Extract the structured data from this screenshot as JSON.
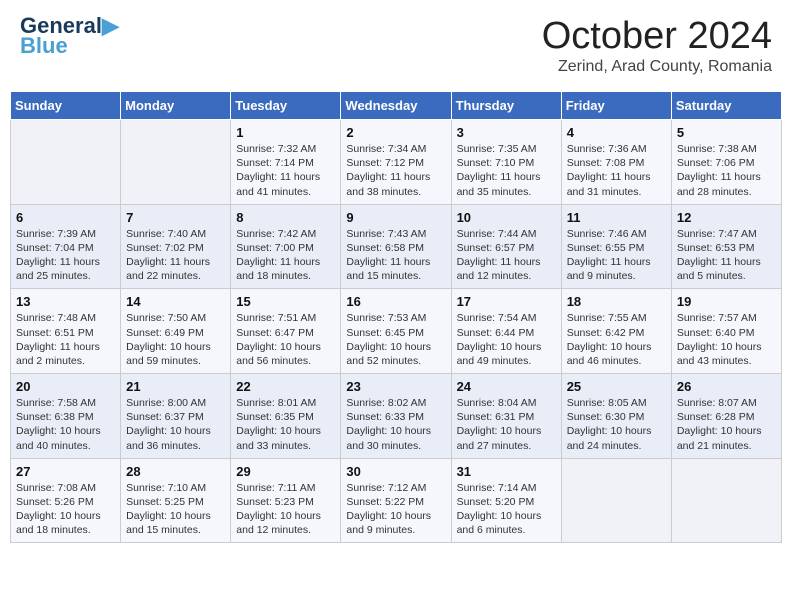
{
  "header": {
    "logo_general": "General",
    "logo_blue": "Blue",
    "title": "October 2024",
    "subtitle": "Zerind, Arad County, Romania"
  },
  "days_of_week": [
    "Sunday",
    "Monday",
    "Tuesday",
    "Wednesday",
    "Thursday",
    "Friday",
    "Saturday"
  ],
  "weeks": [
    [
      {
        "day": "",
        "sunrise": "",
        "sunset": "",
        "daylight": ""
      },
      {
        "day": "",
        "sunrise": "",
        "sunset": "",
        "daylight": ""
      },
      {
        "day": "1",
        "sunrise": "Sunrise: 7:32 AM",
        "sunset": "Sunset: 7:14 PM",
        "daylight": "Daylight: 11 hours and 41 minutes."
      },
      {
        "day": "2",
        "sunrise": "Sunrise: 7:34 AM",
        "sunset": "Sunset: 7:12 PM",
        "daylight": "Daylight: 11 hours and 38 minutes."
      },
      {
        "day": "3",
        "sunrise": "Sunrise: 7:35 AM",
        "sunset": "Sunset: 7:10 PM",
        "daylight": "Daylight: 11 hours and 35 minutes."
      },
      {
        "day": "4",
        "sunrise": "Sunrise: 7:36 AM",
        "sunset": "Sunset: 7:08 PM",
        "daylight": "Daylight: 11 hours and 31 minutes."
      },
      {
        "day": "5",
        "sunrise": "Sunrise: 7:38 AM",
        "sunset": "Sunset: 7:06 PM",
        "daylight": "Daylight: 11 hours and 28 minutes."
      }
    ],
    [
      {
        "day": "6",
        "sunrise": "Sunrise: 7:39 AM",
        "sunset": "Sunset: 7:04 PM",
        "daylight": "Daylight: 11 hours and 25 minutes."
      },
      {
        "day": "7",
        "sunrise": "Sunrise: 7:40 AM",
        "sunset": "Sunset: 7:02 PM",
        "daylight": "Daylight: 11 hours and 22 minutes."
      },
      {
        "day": "8",
        "sunrise": "Sunrise: 7:42 AM",
        "sunset": "Sunset: 7:00 PM",
        "daylight": "Daylight: 11 hours and 18 minutes."
      },
      {
        "day": "9",
        "sunrise": "Sunrise: 7:43 AM",
        "sunset": "Sunset: 6:58 PM",
        "daylight": "Daylight: 11 hours and 15 minutes."
      },
      {
        "day": "10",
        "sunrise": "Sunrise: 7:44 AM",
        "sunset": "Sunset: 6:57 PM",
        "daylight": "Daylight: 11 hours and 12 minutes."
      },
      {
        "day": "11",
        "sunrise": "Sunrise: 7:46 AM",
        "sunset": "Sunset: 6:55 PM",
        "daylight": "Daylight: 11 hours and 9 minutes."
      },
      {
        "day": "12",
        "sunrise": "Sunrise: 7:47 AM",
        "sunset": "Sunset: 6:53 PM",
        "daylight": "Daylight: 11 hours and 5 minutes."
      }
    ],
    [
      {
        "day": "13",
        "sunrise": "Sunrise: 7:48 AM",
        "sunset": "Sunset: 6:51 PM",
        "daylight": "Daylight: 11 hours and 2 minutes."
      },
      {
        "day": "14",
        "sunrise": "Sunrise: 7:50 AM",
        "sunset": "Sunset: 6:49 PM",
        "daylight": "Daylight: 10 hours and 59 minutes."
      },
      {
        "day": "15",
        "sunrise": "Sunrise: 7:51 AM",
        "sunset": "Sunset: 6:47 PM",
        "daylight": "Daylight: 10 hours and 56 minutes."
      },
      {
        "day": "16",
        "sunrise": "Sunrise: 7:53 AM",
        "sunset": "Sunset: 6:45 PM",
        "daylight": "Daylight: 10 hours and 52 minutes."
      },
      {
        "day": "17",
        "sunrise": "Sunrise: 7:54 AM",
        "sunset": "Sunset: 6:44 PM",
        "daylight": "Daylight: 10 hours and 49 minutes."
      },
      {
        "day": "18",
        "sunrise": "Sunrise: 7:55 AM",
        "sunset": "Sunset: 6:42 PM",
        "daylight": "Daylight: 10 hours and 46 minutes."
      },
      {
        "day": "19",
        "sunrise": "Sunrise: 7:57 AM",
        "sunset": "Sunset: 6:40 PM",
        "daylight": "Daylight: 10 hours and 43 minutes."
      }
    ],
    [
      {
        "day": "20",
        "sunrise": "Sunrise: 7:58 AM",
        "sunset": "Sunset: 6:38 PM",
        "daylight": "Daylight: 10 hours and 40 minutes."
      },
      {
        "day": "21",
        "sunrise": "Sunrise: 8:00 AM",
        "sunset": "Sunset: 6:37 PM",
        "daylight": "Daylight: 10 hours and 36 minutes."
      },
      {
        "day": "22",
        "sunrise": "Sunrise: 8:01 AM",
        "sunset": "Sunset: 6:35 PM",
        "daylight": "Daylight: 10 hours and 33 minutes."
      },
      {
        "day": "23",
        "sunrise": "Sunrise: 8:02 AM",
        "sunset": "Sunset: 6:33 PM",
        "daylight": "Daylight: 10 hours and 30 minutes."
      },
      {
        "day": "24",
        "sunrise": "Sunrise: 8:04 AM",
        "sunset": "Sunset: 6:31 PM",
        "daylight": "Daylight: 10 hours and 27 minutes."
      },
      {
        "day": "25",
        "sunrise": "Sunrise: 8:05 AM",
        "sunset": "Sunset: 6:30 PM",
        "daylight": "Daylight: 10 hours and 24 minutes."
      },
      {
        "day": "26",
        "sunrise": "Sunrise: 8:07 AM",
        "sunset": "Sunset: 6:28 PM",
        "daylight": "Daylight: 10 hours and 21 minutes."
      }
    ],
    [
      {
        "day": "27",
        "sunrise": "Sunrise: 7:08 AM",
        "sunset": "Sunset: 5:26 PM",
        "daylight": "Daylight: 10 hours and 18 minutes."
      },
      {
        "day": "28",
        "sunrise": "Sunrise: 7:10 AM",
        "sunset": "Sunset: 5:25 PM",
        "daylight": "Daylight: 10 hours and 15 minutes."
      },
      {
        "day": "29",
        "sunrise": "Sunrise: 7:11 AM",
        "sunset": "Sunset: 5:23 PM",
        "daylight": "Daylight: 10 hours and 12 minutes."
      },
      {
        "day": "30",
        "sunrise": "Sunrise: 7:12 AM",
        "sunset": "Sunset: 5:22 PM",
        "daylight": "Daylight: 10 hours and 9 minutes."
      },
      {
        "day": "31",
        "sunrise": "Sunrise: 7:14 AM",
        "sunset": "Sunset: 5:20 PM",
        "daylight": "Daylight: 10 hours and 6 minutes."
      },
      {
        "day": "",
        "sunrise": "",
        "sunset": "",
        "daylight": ""
      },
      {
        "day": "",
        "sunrise": "",
        "sunset": "",
        "daylight": ""
      }
    ]
  ]
}
